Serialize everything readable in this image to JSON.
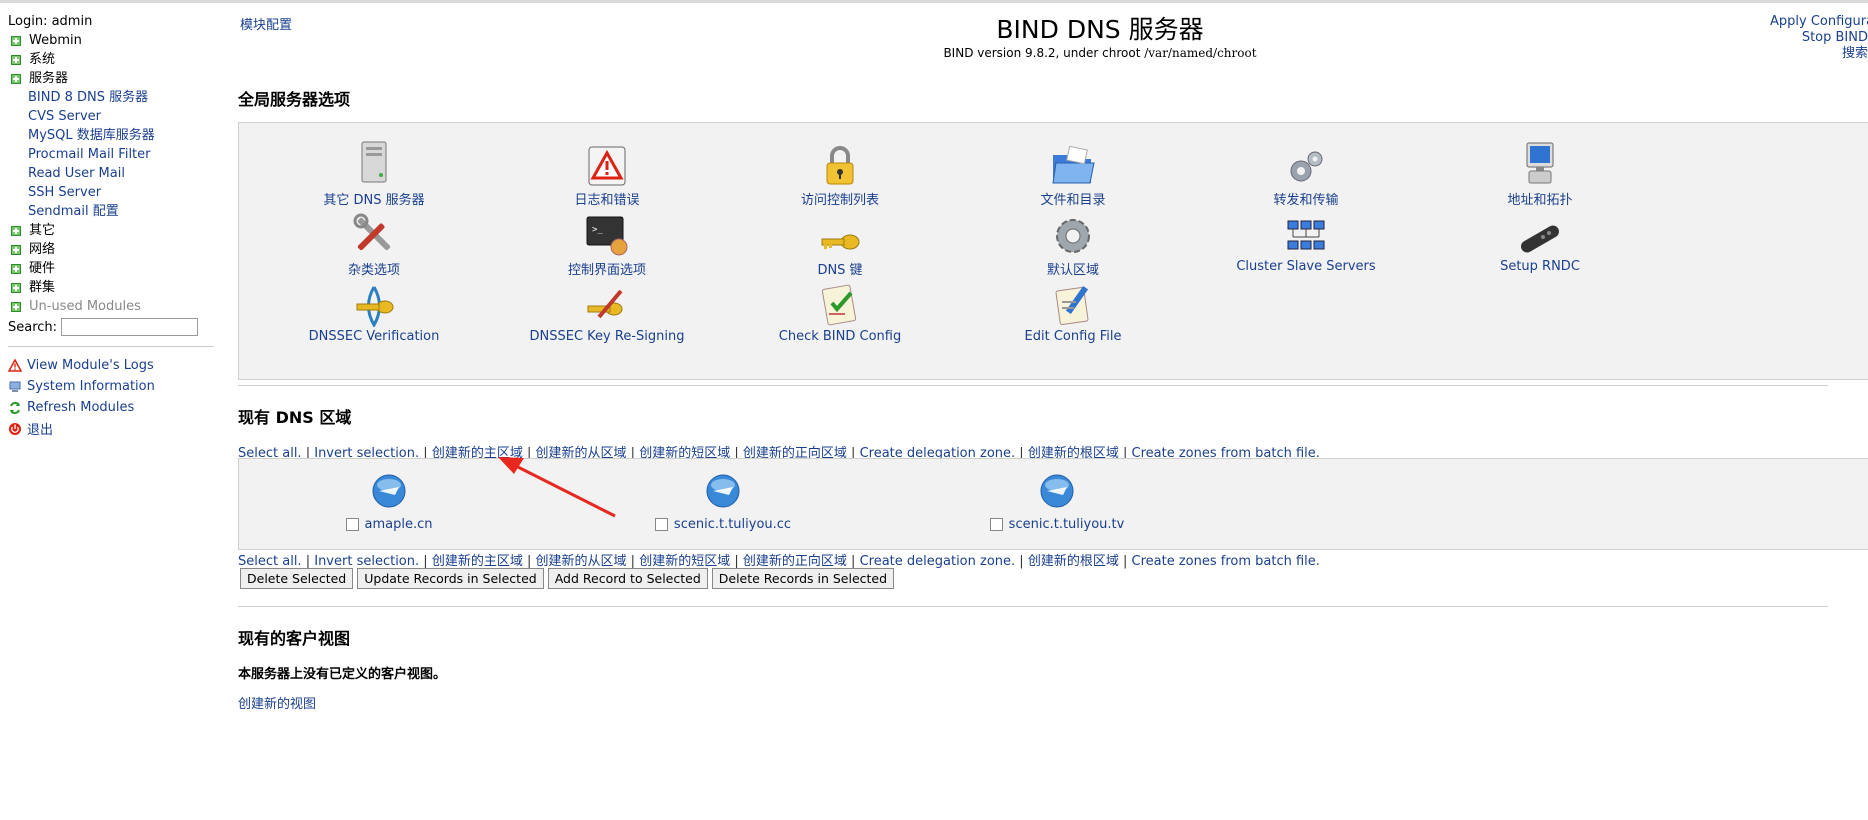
{
  "sidebar": {
    "login": "Login: admin",
    "categories_top": [
      {
        "label": "Webmin"
      },
      {
        "label": "系统"
      },
      {
        "label": "服务器"
      }
    ],
    "server_items": [
      {
        "label": "BIND 8 DNS 服务器"
      },
      {
        "label": "CVS Server"
      },
      {
        "label": "MySQL 数据库服务器"
      },
      {
        "label": "Procmail Mail Filter"
      },
      {
        "label": "Read User Mail"
      },
      {
        "label": "SSH Server"
      },
      {
        "label": "Sendmail 配置"
      }
    ],
    "categories_bottom": [
      {
        "label": "其它"
      },
      {
        "label": "网络"
      },
      {
        "label": "硬件"
      },
      {
        "label": "群集"
      }
    ],
    "unused": "Un-used Modules",
    "search_label": "Search:",
    "search_value": "",
    "actions": [
      {
        "label": "View Module's Logs",
        "icon": "warning-icon"
      },
      {
        "label": "System Information",
        "icon": "system-info-icon"
      },
      {
        "label": "Refresh Modules",
        "icon": "refresh-icon"
      },
      {
        "label": "退出",
        "icon": "logout-icon"
      }
    ]
  },
  "header": {
    "module_config": "模块配置",
    "title": "BIND DNS 服务器",
    "subtitle_prefix": "BIND version 9.8.2, under chroot ",
    "subtitle_path": "/var/named/chroot",
    "right_links": [
      "Apply Configuration",
      "Stop BIND",
      "搜索"
    ]
  },
  "global": {
    "title": "全局服务器选项",
    "options": [
      {
        "label": "其它 DNS 服务器",
        "icon": "server-icon"
      },
      {
        "label": "日志和错误",
        "icon": "warning-icon"
      },
      {
        "label": "访问控制列表",
        "icon": "lock-icon"
      },
      {
        "label": "文件和目录",
        "icon": "folder-icon"
      },
      {
        "label": "转发和传输",
        "icon": "gears-icon"
      },
      {
        "label": "地址和拓扑",
        "icon": "monitor-icon"
      },
      {
        "label": "杂类选项",
        "icon": "tools-icon"
      },
      {
        "label": "控制界面选项",
        "icon": "terminal-icon"
      },
      {
        "label": "DNS 键",
        "icon": "key-icon"
      },
      {
        "label": "默认区域",
        "icon": "gear-icon"
      },
      {
        "label": "Cluster Slave Servers",
        "icon": "cluster-icon"
      },
      {
        "label": "Setup RNDC",
        "icon": "remote-icon"
      },
      {
        "label": "DNSSEC Verification",
        "icon": "dnssec-key-icon"
      },
      {
        "label": "DNSSEC Key Re-Signing",
        "icon": "key-sign-icon"
      },
      {
        "label": "Check BIND Config",
        "icon": "checklist-icon"
      },
      {
        "label": "Edit Config File",
        "icon": "edit-icon"
      }
    ]
  },
  "zones": {
    "title": "现有 DNS 区域",
    "links": [
      "Select all.",
      "Invert selection.",
      "创建新的主区域",
      "创建新的从区域",
      "创建新的短区域",
      "创建新的正向区域",
      "Create delegation zone.",
      "创建新的根区域",
      "Create zones from batch file."
    ],
    "items": [
      {
        "name": "amaple.cn",
        "icon": "zone-globe-icon"
      },
      {
        "name": "scenic.t.tuliyou.cc",
        "icon": "zone-globe-icon"
      },
      {
        "name": "scenic.t.tuliyou.tv",
        "icon": "zone-globe-icon"
      }
    ],
    "buttons": [
      "Delete Selected",
      "Update Records in Selected",
      "Add Record to Selected",
      "Delete Records in Selected"
    ]
  },
  "views": {
    "title": "现有的客户视图",
    "empty": "本服务器上没有已定义的客户视图。",
    "create": "创建新的视图"
  },
  "colors": {
    "link": "#1a3f8f",
    "panel_bg": "#f2f2f2",
    "arrow": "#e8281e"
  }
}
